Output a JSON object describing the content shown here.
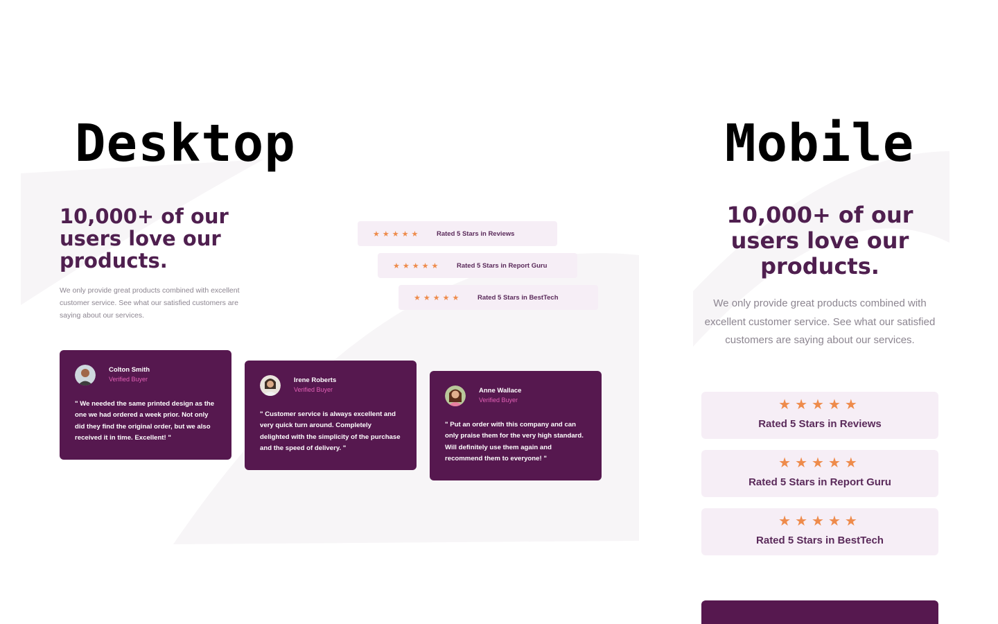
{
  "labels": {
    "desktop": "Desktop",
    "mobile": "Mobile"
  },
  "colors": {
    "primary": "#56184f",
    "heading": "#4f1f4f",
    "accent_pink": "#e260b6",
    "star": "#ee8b4b",
    "rating_bg": "#f6eef6",
    "text_muted": "#8c8590"
  },
  "desktop": {
    "heading": "10,000+ of our users love our products.",
    "paragraph": "We only provide great products combined with excellent customer service. See what our satisfied customers are saying about our services.",
    "ratings": [
      {
        "stars": "★★★★★",
        "text": "Rated 5 Stars in Reviews"
      },
      {
        "stars": "★★★★★",
        "text": "Rated 5 Stars in Report Guru"
      },
      {
        "stars": "★★★★★",
        "text": "Rated 5 Stars in BestTech"
      }
    ],
    "testimonials": [
      {
        "name": "Colton Smith",
        "role": "Verified Buyer",
        "quote": "\" We needed the same printed design as the one we had ordered a week prior. Not only did they find the original order, but we also received it in time. Excellent! \""
      },
      {
        "name": "Irene Roberts",
        "role": "Verified Buyer",
        "quote": "\" Customer service is always excellent and very quick turn around. Completely delighted with the simplicity of the purchase and the speed of delivery. \""
      },
      {
        "name": "Anne Wallace",
        "role": "Verified Buyer",
        "quote": "\" Put an order with this company and can only praise them for the very high standard. Will definitely use them again and recommend them to everyone! \""
      }
    ]
  },
  "mobile": {
    "heading": "10,000+ of our users love our products.",
    "paragraph": "We only provide great products combined with excellent customer service. See what our satisfied customers are saying about our services.",
    "ratings": [
      {
        "stars": "★★★★★",
        "text": "Rated 5 Stars in Reviews"
      },
      {
        "stars": "★★★★★",
        "text": "Rated 5 Stars in Report Guru"
      },
      {
        "stars": "★★★★★",
        "text": "Rated 5 Stars in BestTech"
      }
    ]
  }
}
